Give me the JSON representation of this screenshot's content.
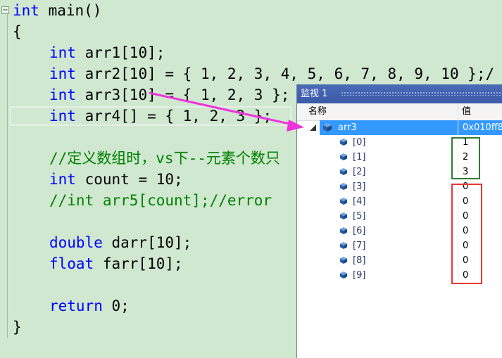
{
  "editor": {
    "collapse_symbol": "−",
    "lines": {
      "l1_kw": "int",
      "l1_rest": " main()",
      "l2": "{",
      "l3_kw": "int",
      "l3_rest": " arr1[10];",
      "l4_kw": "int",
      "l4_rest": " arr2[10] = { 1, 2, 3, 4, 5, 6, 7, 8, 9, 10 };/",
      "l5_kw": "int",
      "l5_rest": " arr3[10] = { 1, 2, 3 };",
      "l6_kw": "int",
      "l6_rest": " arr4[] = { 1, 2, 3 };",
      "l7_cm": "//定义数组时，vs下--元素个数只",
      "l8_kw": "int",
      "l8_rest": " count = 10;",
      "l9_cm": "//int arr5[count];//error",
      "l10_kw": "double",
      "l10_rest": " darr[10];",
      "l11_kw": "float",
      "l11_rest": " farr[10];",
      "l12_kw": "return",
      "l12_rest": " 0;",
      "l13": "}"
    }
  },
  "watch": {
    "title": "监视 1",
    "col_name": "名称",
    "col_value": "值",
    "rows": [
      {
        "name": "arr3",
        "value": "0x010ff8"
      },
      {
        "name": "[0]",
        "value": "1"
      },
      {
        "name": "[1]",
        "value": "2"
      },
      {
        "name": "[2]",
        "value": "3"
      },
      {
        "name": "[3]",
        "value": "0"
      },
      {
        "name": "[4]",
        "value": "0"
      },
      {
        "name": "[5]",
        "value": "0"
      },
      {
        "name": "[6]",
        "value": "0"
      },
      {
        "name": "[7]",
        "value": "0"
      },
      {
        "name": "[8]",
        "value": "0"
      },
      {
        "name": "[9]",
        "value": "0"
      }
    ]
  },
  "colors": {
    "arrow": "#ee33dd",
    "green_box": "#2e7d32",
    "red_box": "#e53935",
    "selection": "#3399ff"
  },
  "icons": {
    "collapse": "minus-icon",
    "row_type": "cube-icon",
    "expander": "triangle-expanded-icon"
  }
}
